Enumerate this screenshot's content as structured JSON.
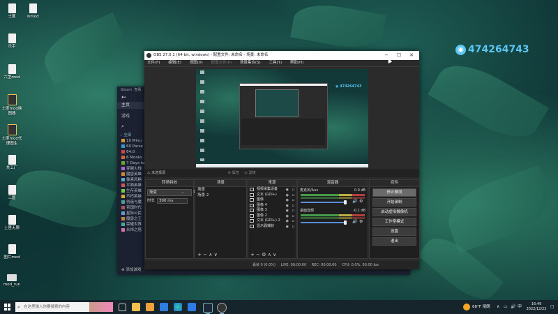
{
  "desktop": {
    "icons": [
      "土匪",
      "inmod",
      "土匪",
      "示手",
      "土匪",
      "六型mod",
      "土匪mod换图器",
      "土匪mod代理图生",
      "共工厂",
      "三国",
      "土匪无限",
      "图片mod",
      "mod_run"
    ],
    "watermark": "474264743"
  },
  "steam": {
    "tab_label": "Steam",
    "menu_item": "查看",
    "nav_home": "主页",
    "nav_games": "游戏",
    "section_all": "全部",
    "games": [
      "10 Minu",
      "60 Parse",
      "64.0",
      "6 Monks",
      "7 Days to",
      "穿越火线",
      "魔兽英雄",
      "像素风格",
      "平面英雄",
      "生存英雄",
      "不朽英雄",
      "创造与魔",
      "帝国时代",
      "星际公民",
      "魔兽之王",
      "荣耀世界",
      "永恒之塔"
    ],
    "add_game": "添加游戏"
  },
  "obs": {
    "title": "OBS 27.0.1 (64-bit, windows) - 配置文件: 未命名 - 场景: 未命名",
    "menu": [
      "文件(F)",
      "编辑(E)",
      "视图(V)",
      "配置文件(P)",
      "场景集合(S)",
      "工具(T)",
      "帮助(H)"
    ],
    "source_toolbar": {
      "selected": "未选择源",
      "props": "属性",
      "filter": "滤镜"
    },
    "docks": {
      "transitions": {
        "header": "转场特效",
        "type_value": "渐变",
        "duration_label": "时长",
        "duration_value": "300 ms"
      },
      "scenes": {
        "header": "场景",
        "items": [
          "场景",
          "场景 2"
        ]
      },
      "sources": {
        "header": "来源",
        "items": [
          "视频采集设备",
          "文本 (GDI+)",
          "图像",
          "图像 4",
          "图像 3",
          "图像 2",
          "文本 (GDI+) 2",
          "显示器捕获"
        ]
      },
      "mixer": {
        "header": "混音器",
        "channels": [
          {
            "name": "麦克风/Aux",
            "db": "0.0 dB"
          },
          {
            "name": "桌面音频",
            "db": "-0.1 dB"
          }
        ]
      },
      "controls": {
        "header": "控件",
        "buttons": [
          "停止推流",
          "开始录制",
          "启动虚拟摄像机",
          "工作室模式",
          "设置",
          "退出"
        ]
      }
    },
    "status": {
      "drop": "丢帧 0 (0.0%)",
      "live": "LIVE: 00:00:00",
      "rec": "REC: 00:00:00",
      "cpu": "CPU: 0.0%, 60.00 fps"
    }
  },
  "taskbar": {
    "search_placeholder": "在这里输入你要搜索的内容",
    "weather": "68°F 晴朗",
    "lang": "中",
    "time": "16:49",
    "date": "2022/12/22"
  },
  "colors": {
    "accent": "#5bc6f4",
    "obs_bg": "#2b2b2b",
    "meter_green": "#4caf50"
  }
}
